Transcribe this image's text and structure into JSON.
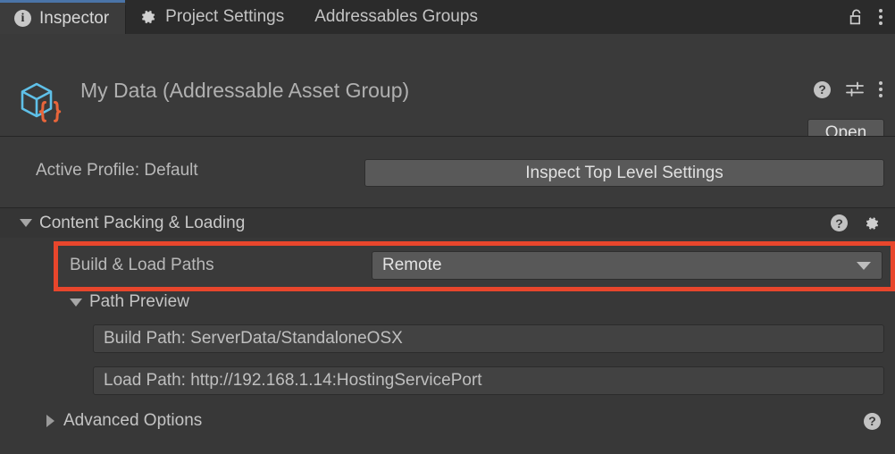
{
  "window": {
    "tabs": [
      {
        "label": "Inspector",
        "icon": "info-icon",
        "active": true
      },
      {
        "label": "Project Settings",
        "icon": "gear-icon",
        "active": false
      },
      {
        "label": "Addressables Groups",
        "icon": "",
        "active": false
      }
    ],
    "lock_icon": "unlocked-padlock-icon",
    "overflow_icon": "kebab-menu-icon"
  },
  "asset_header": {
    "title": "My Data (Addressable Asset Group)",
    "icon": "scriptable-object-cube-braces-icon",
    "help_icon": "help-icon",
    "preset_icon": "preset-sliders-icon",
    "overflow_icon": "kebab-menu-icon",
    "open_label": "Open"
  },
  "profile": {
    "label": "Active Profile: Default",
    "inspect_button_label": "Inspect Top Level Settings"
  },
  "content_section": {
    "title": "Content Packing & Loading",
    "expanded": true,
    "help_icon": "help-icon",
    "settings_icon": "gear-icon"
  },
  "build_load_paths": {
    "label": "Build & Load Paths",
    "value": "Remote",
    "dropdown_icon": "chevron-down-icon",
    "highlight_color": "#e8462c"
  },
  "path_preview": {
    "title": "Path Preview",
    "expanded": true,
    "build_path": "Build Path: ServerData/StandaloneOSX",
    "load_path": "Load Path: http://192.168.1.14:HostingServicePort"
  },
  "advanced_options": {
    "title": "Advanced Options",
    "expanded": false,
    "help_icon": "help-icon"
  },
  "colors": {
    "background": "#383838",
    "panel": "#3a3a3a",
    "tabbar": "#2b2b2b",
    "active_tab_accent": "#4a74a8",
    "highlight": "#e8462c",
    "icon_blue": "#5fc0e8",
    "icon_orange": "#e8653a"
  }
}
